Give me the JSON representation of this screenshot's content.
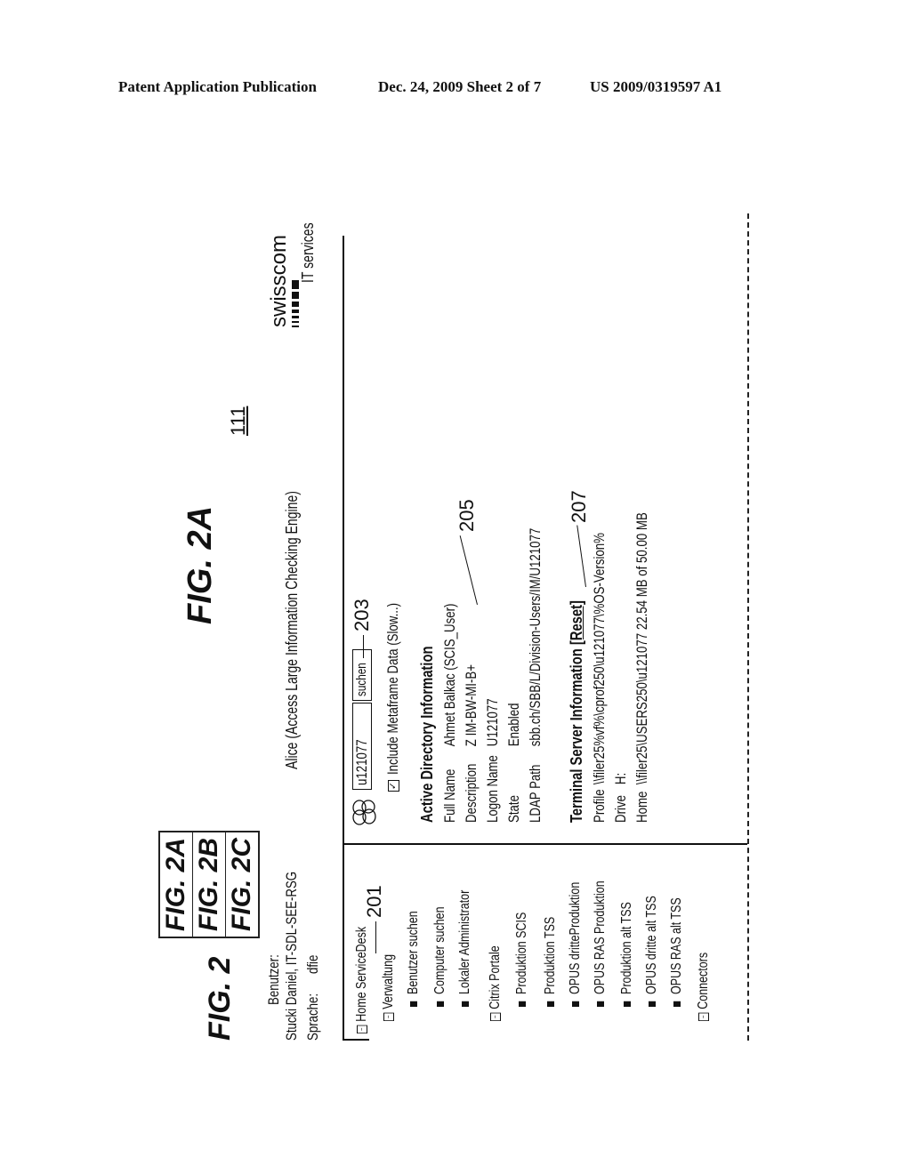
{
  "header": {
    "publication": "Patent Application Publication",
    "date_sheet": "Dec. 24, 2009   Sheet 2 of 7",
    "patent_number": "US 2009/0319597 A1"
  },
  "figure": {
    "main_label": "FIG. 2",
    "key_labels": [
      "FIG. 2A",
      "FIG. 2B",
      "FIG. 2C"
    ],
    "sub_label": "FIG. 2A",
    "ref_111": "111"
  },
  "user_info": {
    "benutzer_label": "Benutzer:",
    "benutzer_value": "Stucki Daniel, IT-SDL-SEE-RSG",
    "sprache_label": "Sprache:",
    "sprache_value": "dfie"
  },
  "app": {
    "title": "Alice (Access Large Information Checking Engine)",
    "logo_name": "swisscom",
    "logo_sub": "IT services"
  },
  "sidebar": {
    "ref": "201",
    "items": [
      {
        "label": "Home ServiceDesk",
        "icon": "collapse-box",
        "level": 0
      },
      {
        "label": "Verwaltung",
        "icon": "collapse-box",
        "level": 1
      },
      {
        "label": "Benutzer suchen",
        "icon": "bullet-square",
        "level": 2
      },
      {
        "label": "Computer suchen",
        "icon": "bullet-square",
        "level": 2
      },
      {
        "label": "Lokaler Administrator",
        "icon": "bullet-square",
        "level": 2
      },
      {
        "label": "Citrix Portale",
        "icon": "collapse-box",
        "level": 1
      },
      {
        "label": "Produktion SCIS",
        "icon": "bullet-square",
        "level": 2
      },
      {
        "label": "Produktion TSS",
        "icon": "bullet-square",
        "level": 2
      },
      {
        "label": "OPUS dritteProduktion",
        "icon": "bullet-square",
        "level": 2
      },
      {
        "label": "OPUS RAS Produktion",
        "icon": "bullet-square",
        "level": 2
      },
      {
        "label": "Produktion alt TSS",
        "icon": "bullet-square",
        "level": 2
      },
      {
        "label": "OPUS dritte alt TSS",
        "icon": "bullet-square",
        "level": 2
      },
      {
        "label": "OPUS RAS alt TSS",
        "icon": "bullet-square",
        "level": 2
      },
      {
        "label": "Connectors",
        "icon": "collapse-box",
        "level": 1
      }
    ]
  },
  "search": {
    "value": "u121077",
    "button": "suchen",
    "ref": "203",
    "checkbox_label": "Include Metaframe Data (Slow...)",
    "checkbox_checked": true
  },
  "ad_info": {
    "title": "Active Directory Information",
    "ref": "205",
    "rows": [
      {
        "label": "Full Name",
        "value": "Ahmet Balkac (SCIS_User)"
      },
      {
        "label": "Description",
        "value": "Z IM-BW-MI-B+"
      },
      {
        "label": "Logon Name",
        "value": "U121077"
      },
      {
        "label": "State",
        "value": "Enabled"
      },
      {
        "label": "LDAP Path",
        "value": "sbb.ch/SBB/L/Division-Users/IM/U121077"
      }
    ]
  },
  "ts_info": {
    "title": "Terminal Server Information",
    "reset_link": "[Reset]",
    "ref": "207",
    "rows": [
      {
        "label": "Profile",
        "value": "\\\\filer25%vf%\\cprof250\\u121077\\%OS-Version%"
      },
      {
        "label": "Drive",
        "value": "H:"
      },
      {
        "label": "Home",
        "value": "\\\\filer25\\USERS250\\u121077 22.54 MB of 50.00 MB"
      }
    ]
  }
}
